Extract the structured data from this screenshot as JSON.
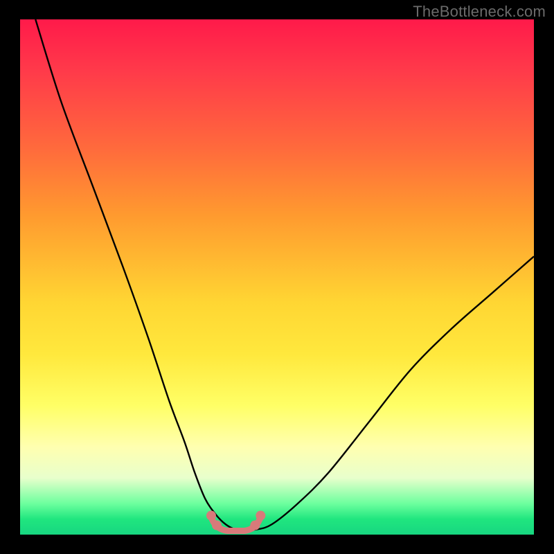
{
  "watermark": "TheBottleneck.com",
  "chart_data": {
    "type": "line",
    "title": "",
    "xlabel": "",
    "ylabel": "",
    "xlim": [
      0,
      100
    ],
    "ylim": [
      0,
      100
    ],
    "series": [
      {
        "name": "bottleneck-curve",
        "x": [
          3,
          8,
          14,
          20,
          25,
          29,
          32,
          34,
          36,
          38,
          40,
          42,
          44,
          46,
          49,
          54,
          60,
          68,
          76,
          84,
          92,
          100
        ],
        "values": [
          100,
          84,
          68,
          52,
          38,
          26,
          18,
          12,
          7,
          4,
          2,
          1,
          1,
          1,
          2,
          6,
          12,
          22,
          32,
          40,
          47,
          54
        ]
      }
    ],
    "annotations": [
      {
        "name": "floor-segment",
        "x_range": [
          38,
          46
        ],
        "value": 1
      }
    ],
    "gradient_stops": [
      {
        "pos": 0.0,
        "color": "#ff1a4a"
      },
      {
        "pos": 0.25,
        "color": "#ff6a3c"
      },
      {
        "pos": 0.55,
        "color": "#ffd633"
      },
      {
        "pos": 0.8,
        "color": "#ffff99"
      },
      {
        "pos": 0.95,
        "color": "#4eff92"
      },
      {
        "pos": 1.0,
        "color": "#17d680"
      }
    ]
  }
}
